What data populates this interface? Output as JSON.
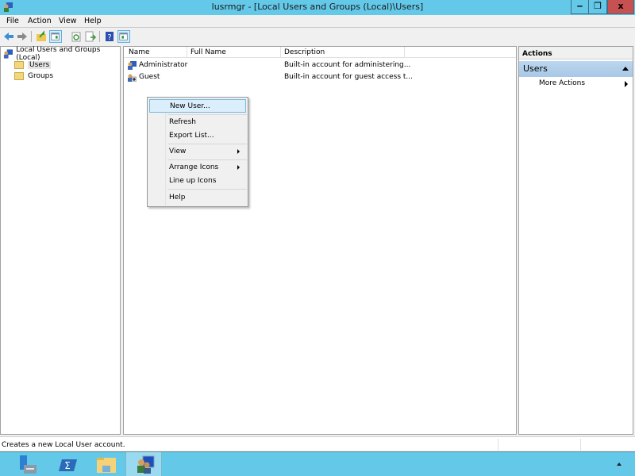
{
  "window": {
    "title": "lusrmgr - [Local Users and Groups (Local)\\Users]",
    "controls": {
      "minimize": "minimize",
      "restore": "restore",
      "close": "x"
    }
  },
  "menubar": {
    "items": [
      "File",
      "Action",
      "View",
      "Help"
    ]
  },
  "toolbar": {
    "buttons": [
      "back-icon",
      "forward-icon",
      "up-folder-icon",
      "show-hide-tree-icon",
      "refresh-icon",
      "export-list-icon",
      "help-icon",
      "show-hide-action-pane-icon"
    ]
  },
  "tree": {
    "root": "Local Users and Groups (Local)",
    "children": [
      "Users",
      "Groups"
    ],
    "selected": "Users"
  },
  "list": {
    "columns": [
      "Name",
      "Full Name",
      "Description"
    ],
    "rows": [
      {
        "name": "Administrator",
        "full_name": "",
        "description": "Built-in account for administering..."
      },
      {
        "name": "Guest",
        "full_name": "",
        "description": "Built-in account for guest access t..."
      }
    ]
  },
  "context_menu": {
    "items": [
      "New User...",
      "Refresh",
      "Export List...",
      "View",
      "Arrange Icons",
      "Line up Icons",
      "Help"
    ],
    "highlighted": "New User..."
  },
  "actions": {
    "title": "Actions",
    "group": "Users",
    "items": [
      "More Actions"
    ]
  },
  "statusbar": {
    "text": "Creates a new Local User account."
  },
  "taskbar": {
    "apps": [
      "server-manager-icon",
      "powershell-icon",
      "file-explorer-icon",
      "lusrmgr-icon"
    ],
    "active": "lusrmgr-icon"
  },
  "colors": {
    "titlebar": "#64c8e8",
    "close": "#c75050",
    "taskbar": "#64c8e8",
    "highlight": "#dbeefc"
  }
}
